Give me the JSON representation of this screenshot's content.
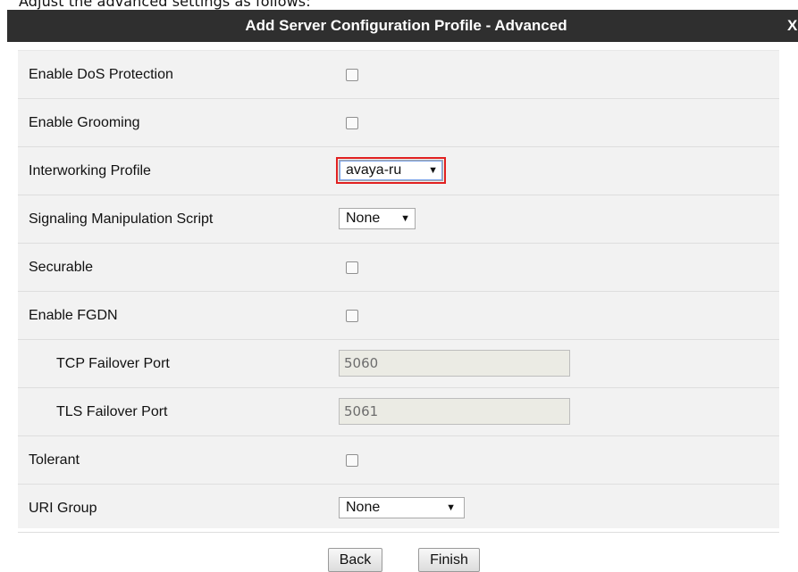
{
  "intro_text": "Adjust the advanced settings as follows:",
  "dialog": {
    "title": "Add Server Configuration Profile - Advanced",
    "close_label": "X"
  },
  "fields": {
    "dos_protection": {
      "label": "Enable DoS Protection",
      "checked": false
    },
    "grooming": {
      "label": "Enable Grooming",
      "checked": false
    },
    "interworking": {
      "label": "Interworking Profile",
      "value": "avaya-ru"
    },
    "sig_script": {
      "label": "Signaling Manipulation Script",
      "value": "None"
    },
    "securable": {
      "label": "Securable",
      "checked": false
    },
    "fgdn": {
      "label": "Enable FGDN",
      "checked": false
    },
    "tcp_port": {
      "label": "TCP Failover Port",
      "value": "5060"
    },
    "tls_port": {
      "label": "TLS Failover Port",
      "value": "5061"
    },
    "tolerant": {
      "label": "Tolerant",
      "checked": false
    },
    "uri_group": {
      "label": "URI Group",
      "value": "None"
    }
  },
  "buttons": {
    "back": "Back",
    "finish": "Finish"
  },
  "colors": {
    "title_bar": "#2f2f2f",
    "panel": "#f2f2f2",
    "highlight": "#e02020"
  }
}
